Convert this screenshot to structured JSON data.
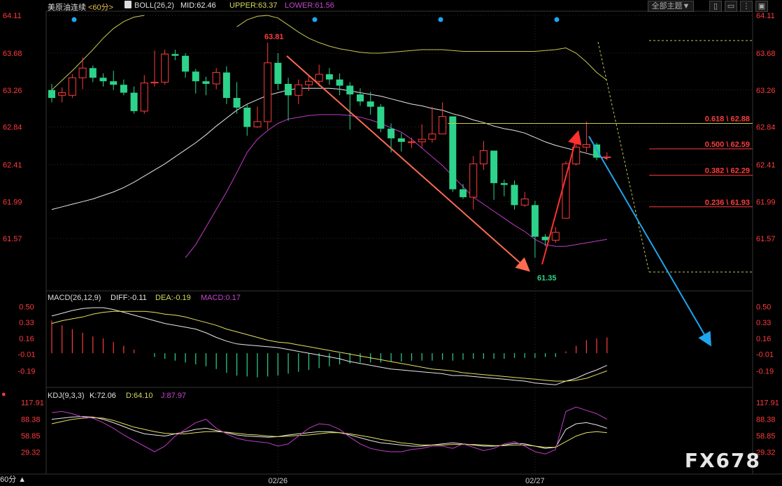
{
  "header": {
    "symbol": "美原油连续",
    "period_tag": "<60分>",
    "indicator": "BOLL(26,2)",
    "mid": "MID:62.46",
    "upper": "UPPER:63.37",
    "lower": "LOWER:61.56",
    "theme_button": "全部主题",
    "theme_arrow": "▼"
  },
  "macd_header": {
    "name": "MACD(26,12,9)",
    "diff": "DIFF:-0.11",
    "dea": "DEA:-0.19",
    "macd": "MACD:0.17"
  },
  "kdj_header": {
    "name": "KDJ(9,3,3)",
    "k": "K:72.06",
    "d": "D:64.10",
    "j": "J:87.97"
  },
  "period_label": "60分 ▲",
  "watermark": "FX678",
  "colors": {
    "up": "#ff3b3b",
    "down": "#2dd38a",
    "mid": "#e8e8e8",
    "upper": "#c8c850",
    "lower": "#c03cc8",
    "dea": "#e8e060",
    "blue": "#1ea6ee",
    "arrow_red": "#ff3030",
    "arrow_salmon": "#ff6a50"
  },
  "chart_data": [
    {
      "type": "candlestick",
      "price_ticks": [
        "64.11",
        "63.68",
        "63.26",
        "62.84",
        "62.41",
        "61.99",
        "61.57"
      ],
      "ylim": [
        61.18,
        64.11
      ],
      "x_labels": [
        "02/26",
        "02/27"
      ],
      "annotations": {
        "high": "63.81",
        "low": "61.35"
      },
      "fib_levels": [
        {
          "label": "0.618 \\ 62.88",
          "value": 62.88
        },
        {
          "label": "0.500 \\ 62.59",
          "value": 62.59
        },
        {
          "label": "0.382 \\ 62.29",
          "value": 62.29
        },
        {
          "label": "0.236 \\ 61.93",
          "value": 61.93
        }
      ],
      "candles": [
        [
          63.26,
          63.17,
          63.33,
          63.12
        ],
        [
          63.2,
          63.23,
          63.29,
          63.12
        ],
        [
          63.2,
          63.4,
          63.44,
          63.17
        ],
        [
          63.4,
          63.51,
          63.63,
          63.27
        ],
        [
          63.51,
          63.4,
          63.54,
          63.35
        ],
        [
          63.4,
          63.36,
          63.45,
          63.3
        ],
        [
          63.36,
          63.32,
          63.48,
          63.26
        ],
        [
          63.32,
          63.23,
          63.38,
          63.2
        ],
        [
          63.23,
          63.02,
          63.3,
          62.99
        ],
        [
          63.02,
          63.34,
          63.43,
          62.99
        ],
        [
          63.34,
          63.35,
          63.71,
          63.3
        ],
        [
          63.35,
          63.67,
          63.72,
          63.32
        ],
        [
          63.67,
          63.65,
          63.72,
          63.6
        ],
        [
          63.65,
          63.47,
          63.68,
          63.4
        ],
        [
          63.47,
          63.36,
          63.5,
          63.22
        ],
        [
          63.36,
          63.33,
          63.41,
          63.2
        ],
        [
          63.33,
          63.46,
          63.51,
          63.27
        ],
        [
          63.46,
          63.17,
          63.53,
          63.1
        ],
        [
          63.17,
          63.06,
          63.35,
          62.99
        ],
        [
          63.06,
          62.84,
          63.1,
          62.74
        ],
        [
          62.84,
          62.9,
          63.07,
          62.83
        ],
        [
          62.9,
          63.57,
          63.8,
          62.81
        ],
        [
          63.57,
          63.33,
          63.68,
          63.26
        ],
        [
          63.33,
          63.2,
          63.4,
          62.91
        ],
        [
          63.2,
          63.32,
          63.38,
          63.1
        ],
        [
          63.32,
          63.36,
          63.42,
          63.25
        ],
        [
          63.36,
          63.44,
          63.55,
          63.3
        ],
        [
          63.44,
          63.38,
          63.51,
          63.32
        ],
        [
          63.38,
          63.31,
          63.45,
          63.2
        ],
        [
          63.31,
          63.21,
          63.35,
          62.81
        ],
        [
          63.21,
          63.13,
          63.28,
          63.08
        ],
        [
          63.13,
          63.07,
          63.24,
          62.98
        ],
        [
          63.07,
          62.82,
          63.1,
          62.78
        ],
        [
          62.82,
          62.71,
          62.88,
          62.55
        ],
        [
          62.71,
          62.67,
          62.77,
          62.56
        ],
        [
          62.67,
          62.67,
          62.72,
          62.6
        ],
        [
          62.67,
          62.7,
          62.87,
          62.6
        ],
        [
          62.7,
          62.76,
          63.07,
          62.66
        ],
        [
          62.76,
          62.96,
          63.12,
          62.9
        ],
        [
          62.96,
          62.13,
          62.96,
          62.1
        ],
        [
          62.13,
          62.04,
          62.19,
          62.02
        ],
        [
          62.04,
          62.42,
          62.51,
          61.9
        ],
        [
          62.42,
          62.57,
          62.68,
          62.35
        ],
        [
          62.57,
          62.2,
          62.57,
          62.01
        ],
        [
          62.2,
          62.18,
          62.24,
          62.05
        ],
        [
          62.18,
          61.95,
          62.23,
          61.9
        ],
        [
          61.95,
          62.02,
          62.1,
          61.93
        ],
        [
          61.95,
          61.59,
          62.0,
          61.35
        ],
        [
          61.59,
          61.55,
          61.62,
          61.48
        ],
        [
          61.55,
          61.64,
          61.7,
          61.52
        ],
        [
          61.8,
          62.42,
          62.45,
          61.8
        ],
        [
          62.42,
          62.61,
          62.7,
          62.4
        ],
        [
          62.61,
          62.64,
          62.9,
          62.55
        ],
        [
          62.64,
          62.49,
          62.66,
          62.46
        ],
        [
          62.49,
          62.5,
          62.55,
          62.46
        ]
      ],
      "mid": [
        61.9,
        61.93,
        61.96,
        61.99,
        62.02,
        62.06,
        62.1,
        62.15,
        62.21,
        62.28,
        62.35,
        62.42,
        62.5,
        62.58,
        62.66,
        62.75,
        62.85,
        62.94,
        63.03,
        63.1,
        63.15,
        63.2,
        63.23,
        63.26,
        63.28,
        63.28,
        63.28,
        63.28,
        63.27,
        63.25,
        63.23,
        63.21,
        63.19,
        63.16,
        63.13,
        63.1,
        63.08,
        63.05,
        63.03,
        62.99,
        62.96,
        62.92,
        62.89,
        62.85,
        62.82,
        62.8,
        62.77,
        62.72,
        62.67,
        62.63,
        62.6,
        62.57,
        62.54,
        62.51,
        62.48
      ],
      "upper": [
        63.26,
        63.37,
        63.48,
        63.6,
        63.72,
        63.85,
        63.96,
        64.04,
        64.09,
        64.11,
        null,
        null,
        null,
        null,
        null,
        null,
        null,
        null,
        63.98,
        64.06,
        64.1,
        64.11,
        64.08,
        64.0,
        63.92,
        63.85,
        63.8,
        63.76,
        63.73,
        63.71,
        63.69,
        63.68,
        63.68,
        63.69,
        63.7,
        63.71,
        63.72,
        63.72,
        63.72,
        63.71,
        63.7,
        63.7,
        63.7,
        63.7,
        63.7,
        63.7,
        63.7,
        63.7,
        63.71,
        63.72,
        63.74,
        63.68,
        63.58,
        63.46,
        63.37
      ],
      "lower": [
        null,
        null,
        null,
        null,
        null,
        null,
        null,
        null,
        null,
        null,
        null,
        null,
        null,
        61.35,
        61.5,
        61.7,
        61.9,
        62.1,
        62.32,
        62.55,
        62.7,
        62.8,
        62.88,
        62.93,
        62.95,
        62.97,
        62.98,
        62.98,
        62.98,
        62.97,
        62.95,
        62.92,
        62.88,
        62.83,
        62.78,
        62.7,
        62.6,
        62.5,
        62.4,
        62.28,
        62.16,
        62.04,
        61.96,
        61.88,
        61.8,
        61.72,
        61.65,
        61.56,
        61.5,
        61.48,
        61.48,
        61.5,
        61.52,
        61.54,
        61.56
      ],
      "x_label_positions": [
        22,
        47
      ]
    },
    {
      "type": "macd",
      "ticks": [
        "0.50",
        "0.33",
        "0.16",
        "-0.01",
        "-0.19"
      ],
      "ylim": [
        -0.3,
        0.55
      ],
      "diff": [
        0.4,
        0.43,
        0.46,
        0.48,
        0.49,
        0.49,
        0.47,
        0.44,
        0.41,
        0.38,
        0.35,
        0.32,
        0.3,
        0.28,
        0.26,
        0.22,
        0.17,
        0.13,
        0.1,
        0.09,
        0.08,
        0.07,
        0.06,
        0.04,
        0.02,
        0.0,
        -0.02,
        -0.04,
        -0.06,
        -0.09,
        -0.11,
        -0.13,
        -0.15,
        -0.17,
        -0.18,
        -0.19,
        -0.2,
        -0.21,
        -0.22,
        -0.24,
        -0.24,
        -0.25,
        -0.26,
        -0.27,
        -0.28,
        -0.29,
        -0.3,
        -0.32,
        -0.33,
        -0.34,
        -0.3,
        -0.27,
        -0.22,
        -0.18,
        -0.13
      ],
      "dea": [
        0.32,
        0.35,
        0.37,
        0.39,
        0.42,
        0.44,
        0.45,
        0.45,
        0.45,
        0.45,
        0.44,
        0.42,
        0.41,
        0.39,
        0.36,
        0.33,
        0.3,
        0.26,
        0.23,
        0.2,
        0.17,
        0.14,
        0.12,
        0.11,
        0.09,
        0.07,
        0.05,
        0.03,
        0.01,
        -0.01,
        -0.03,
        -0.05,
        -0.07,
        -0.09,
        -0.11,
        -0.13,
        -0.15,
        -0.17,
        -0.18,
        -0.19,
        -0.21,
        -0.22,
        -0.23,
        -0.24,
        -0.25,
        -0.26,
        -0.27,
        -0.28,
        -0.29,
        -0.3,
        -0.3,
        -0.29,
        -0.27,
        -0.23,
        -0.19
      ],
      "hist": [
        0.35,
        0.3,
        0.26,
        0.22,
        0.18,
        0.16,
        0.12,
        0.08,
        0.04,
        0.0,
        -0.04,
        -0.06,
        -0.08,
        -0.1,
        -0.12,
        -0.14,
        -0.17,
        -0.21,
        -0.24,
        -0.25,
        -0.26,
        -0.25,
        -0.24,
        -0.22,
        -0.2,
        -0.18,
        -0.16,
        -0.14,
        -0.12,
        -0.11,
        -0.1,
        -0.1,
        -0.1,
        -0.09,
        -0.09,
        -0.08,
        -0.08,
        -0.08,
        -0.07,
        -0.08,
        -0.07,
        -0.06,
        -0.06,
        -0.06,
        -0.06,
        -0.05,
        -0.05,
        -0.05,
        -0.04,
        -0.04,
        0.02,
        0.08,
        0.14,
        0.16,
        0.17
      ]
    },
    {
      "type": "kdj",
      "ticks": [
        "117.91",
        "88.38",
        "58.85",
        "29.32"
      ],
      "ylim": [
        10,
        120
      ],
      "k": [
        88,
        90,
        92,
        93,
        92,
        88,
        82,
        75,
        68,
        62,
        60,
        58,
        62,
        66,
        70,
        72,
        68,
        64,
        60,
        58,
        57,
        56,
        57,
        60,
        62,
        64,
        66,
        66,
        64,
        60,
        55,
        50,
        46,
        44,
        42,
        40,
        40,
        42,
        44,
        46,
        44,
        42,
        40,
        40,
        42,
        45,
        44,
        40,
        36,
        38,
        70,
        80,
        82,
        78,
        72
      ],
      "d": [
        80,
        84,
        88,
        90,
        91,
        90,
        86,
        80,
        74,
        70,
        66,
        63,
        62,
        62,
        64,
        66,
        66,
        65,
        63,
        61,
        60,
        58,
        57,
        58,
        59,
        60,
        62,
        64,
        64,
        62,
        59,
        56,
        52,
        49,
        46,
        44,
        42,
        42,
        42,
        43,
        43,
        43,
        42,
        41,
        41,
        42,
        42,
        40,
        38,
        38,
        48,
        58,
        64,
        66,
        64
      ],
      "j": [
        100,
        102,
        98,
        92,
        90,
        82,
        72,
        60,
        50,
        40,
        30,
        40,
        58,
        70,
        82,
        88,
        72,
        62,
        54,
        50,
        48,
        46,
        40,
        44,
        58,
        72,
        80,
        78,
        70,
        56,
        44,
        36,
        32,
        30,
        30,
        34,
        36,
        40,
        40,
        36,
        44,
        38,
        32,
        36,
        44,
        48,
        40,
        30,
        26,
        34,
        102,
        110,
        104,
        98,
        88
      ]
    }
  ]
}
